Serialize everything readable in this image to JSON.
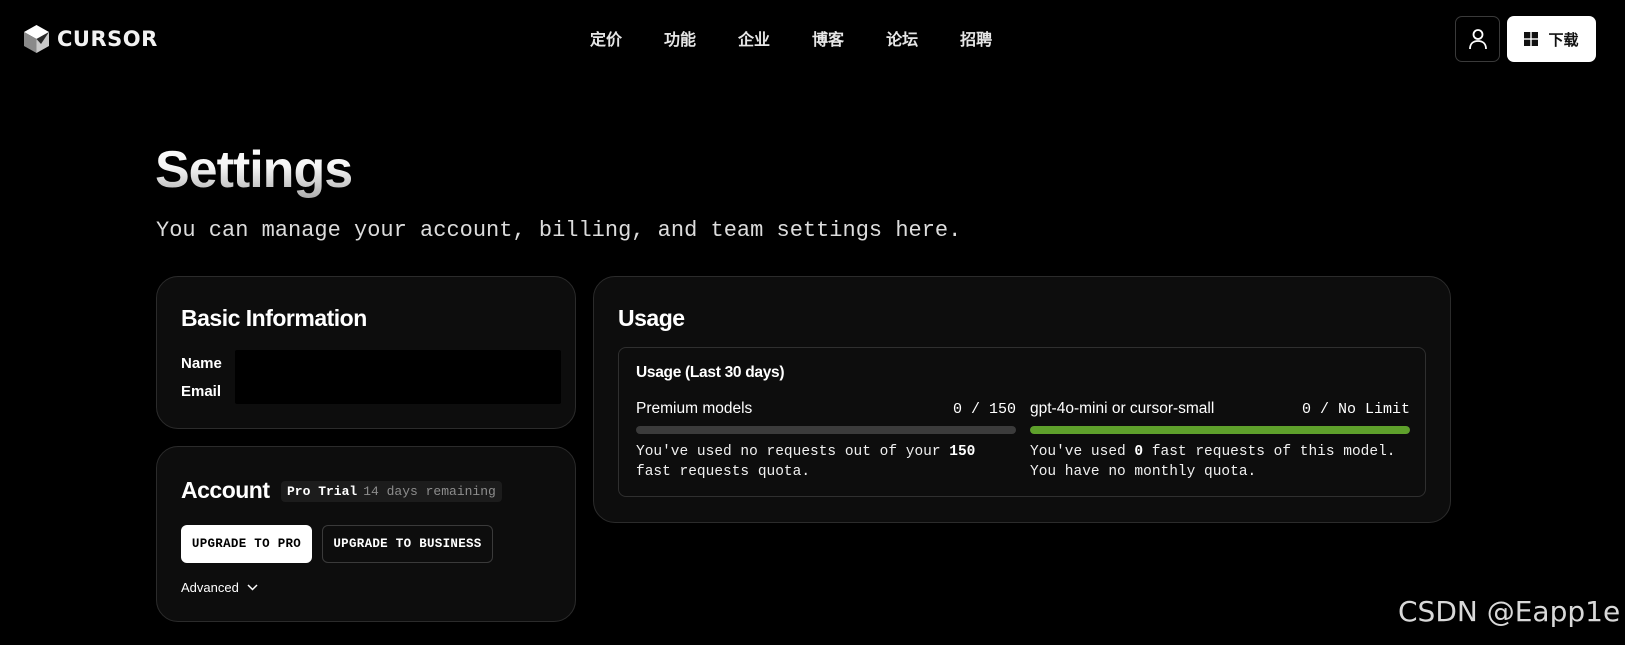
{
  "brand": {
    "name": "CURSOR"
  },
  "nav": {
    "items": [
      "定价",
      "功能",
      "企业",
      "博客",
      "论坛",
      "招聘"
    ]
  },
  "header": {
    "user_icon": "user-icon",
    "download_icon": "windows-icon",
    "download_label": "下载"
  },
  "page": {
    "title": "Settings",
    "subtitle": "You can manage your account, billing, and team settings here."
  },
  "basic_info": {
    "title": "Basic Information",
    "name_label": "Name",
    "email_label": "Email"
  },
  "account": {
    "title": "Account",
    "plan": "Pro Trial",
    "remaining": "14 days remaining",
    "upgrade_pro": "UPGRADE TO PRO",
    "upgrade_business": "UPGRADE TO BUSINESS",
    "advanced": "Advanced",
    "advanced_icon": "chevron-down-icon"
  },
  "usage": {
    "title": "Usage",
    "period_title": "Usage (Last 30 days)",
    "models": [
      {
        "name": "Premium models",
        "count": "0 / 150",
        "fill": 0,
        "desc_a": "You've used no requests out of your ",
        "desc_b": "150",
        "desc_c": " fast requests quota."
      },
      {
        "name": "gpt-4o-mini or cursor-small",
        "count": "0 / No Limit",
        "fill": 1,
        "desc_a": "You've used ",
        "desc_b": "0",
        "desc_c": " fast requests of this model. You have no monthly quota."
      }
    ]
  },
  "colors": {
    "accent_green": "#5ea02b",
    "background": "#000000",
    "card": "#0d0d0d"
  },
  "watermark": "CSDN @Eapp1e"
}
